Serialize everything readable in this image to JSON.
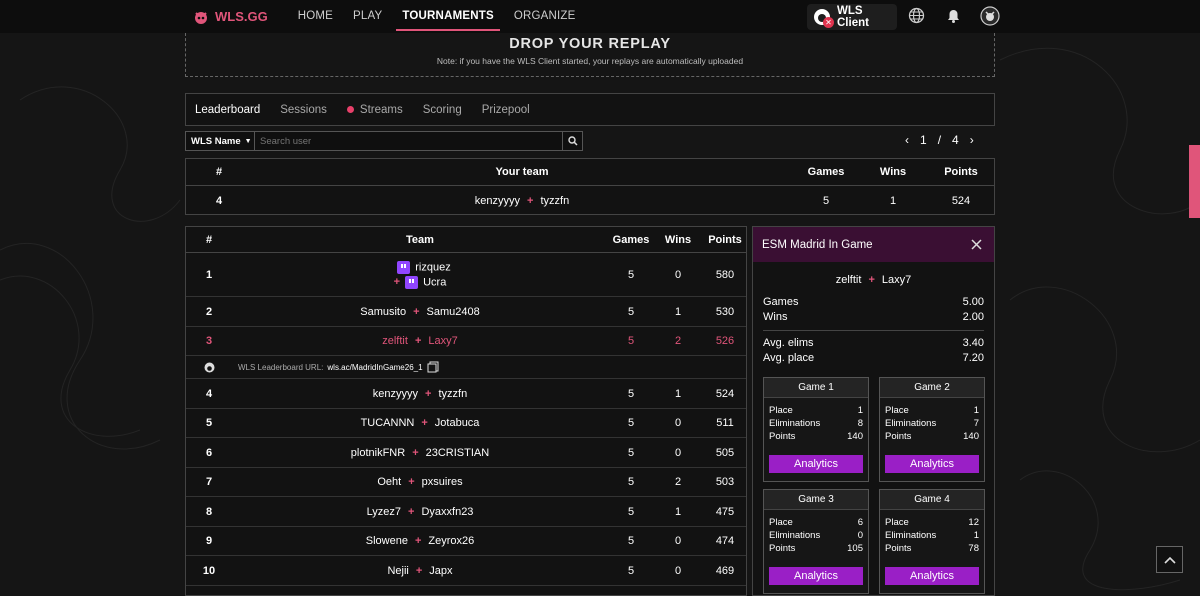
{
  "nav": {
    "brand": "WLS.GG",
    "links": [
      "HOME",
      "PLAY",
      "TOURNAMENTS",
      "ORGANIZE"
    ],
    "active_link": "TOURNAMENTS",
    "client_label": "WLS Client"
  },
  "drop": {
    "title": "DROP YOUR REPLAY",
    "note": "Note: if you have the WLS Client started, your replays are automatically uploaded"
  },
  "tabs": [
    "Leaderboard",
    "Sessions",
    "Streams",
    "Scoring",
    "Prizepool"
  ],
  "active_tab": "Leaderboard",
  "search": {
    "filter": "WLS Name",
    "placeholder": "Search user"
  },
  "pager": {
    "current": "1",
    "separator": "/",
    "total": "4"
  },
  "your_team": {
    "headers": {
      "rank": "#",
      "team": "Your team",
      "games": "Games",
      "wins": "Wins",
      "points": "Points"
    },
    "rank": "4",
    "p1": "kenzyyyy",
    "p2": "tyzzfn",
    "games": "5",
    "wins": "1",
    "points": "524"
  },
  "leaderboard": {
    "headers": {
      "rank": "#",
      "team": "Team",
      "games": "Games",
      "wins": "Wins",
      "points": "Points"
    },
    "url_label": "WLS Leaderboard URL:",
    "url_value": "wls.ac/MadridInGame26_1",
    "rows": [
      {
        "rank": "1",
        "p1": "rizquez",
        "p2": "Ucra",
        "games": "5",
        "wins": "0",
        "points": "580"
      },
      {
        "rank": "2",
        "p1": "Samusito",
        "p2": "Samu2408",
        "games": "5",
        "wins": "1",
        "points": "530"
      },
      {
        "rank": "3",
        "p1": "zelftit",
        "p2": "Laxy7",
        "games": "5",
        "wins": "2",
        "points": "526"
      },
      {
        "rank": "4",
        "p1": "kenzyyyy",
        "p2": "tyzzfn",
        "games": "5",
        "wins": "1",
        "points": "524"
      },
      {
        "rank": "5",
        "p1": "TUCANNN",
        "p2": "Jotabuca",
        "games": "5",
        "wins": "0",
        "points": "511"
      },
      {
        "rank": "6",
        "p1": "plotnikFNR",
        "p2": "23CRISTIAN",
        "games": "5",
        "wins": "0",
        "points": "505"
      },
      {
        "rank": "7",
        "p1": "Oeht",
        "p2": "pxsuires",
        "games": "5",
        "wins": "2",
        "points": "503"
      },
      {
        "rank": "8",
        "p1": "Lyzez7",
        "p2": "Dyaxxfn23",
        "games": "5",
        "wins": "1",
        "points": "475"
      },
      {
        "rank": "9",
        "p1": "Slowene",
        "p2": "Zeyrox26",
        "games": "5",
        "wins": "0",
        "points": "474"
      },
      {
        "rank": "10",
        "p1": "Nejii",
        "p2": "Japx",
        "games": "5",
        "wins": "0",
        "points": "469"
      }
    ]
  },
  "panel": {
    "title": "ESM Madrid In Game",
    "p1": "zelftit",
    "p2": "Laxy7",
    "stats": [
      {
        "label": "Games",
        "value": "5.00"
      },
      {
        "label": "Wins",
        "value": "2.00"
      },
      {
        "label": "Avg. elims",
        "value": "3.40"
      },
      {
        "label": "Avg. place",
        "value": "7.20"
      }
    ],
    "games": [
      {
        "title": "Game 1",
        "place": "1",
        "elims": "8",
        "points": "140"
      },
      {
        "title": "Game 2",
        "place": "1",
        "elims": "7",
        "points": "140"
      },
      {
        "title": "Game 3",
        "place": "6",
        "elims": "0",
        "points": "105"
      },
      {
        "title": "Game 4",
        "place": "12",
        "elims": "1",
        "points": "78"
      }
    ],
    "labels": {
      "place": "Place",
      "elims": "Eliminations",
      "points": "Points",
      "analytics": "Analytics"
    }
  },
  "colors": {
    "accent": "#e0557a",
    "purple": "#9a1fc6",
    "panel_header": "#3a0f33",
    "twitch": "#9146ff"
  }
}
